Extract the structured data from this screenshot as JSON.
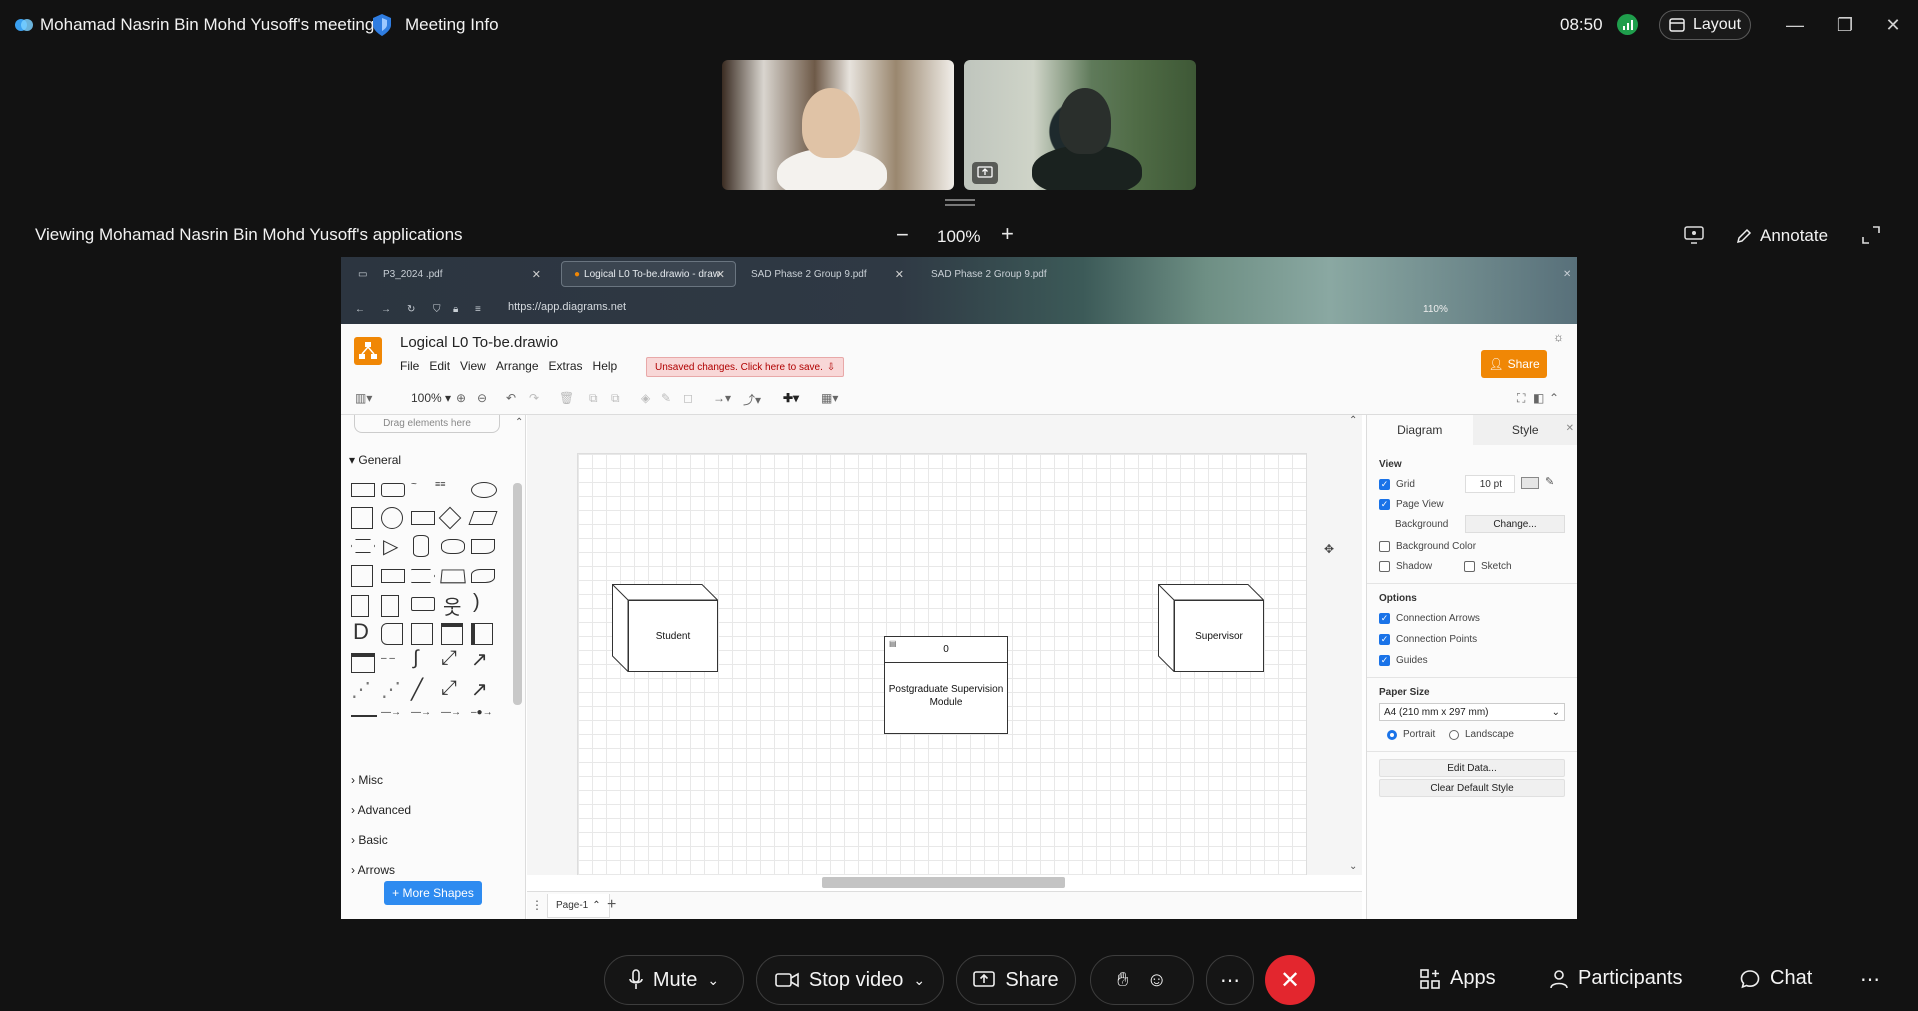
{
  "meeting": {
    "title": "Mohamad Nasrin Bin Mohd Yusoff's meeting",
    "info_label": "Meeting Info",
    "time": "08:50",
    "layout_label": "Layout"
  },
  "viewbar": {
    "viewing_text": "Viewing Mohamad Nasrin Bin Mohd Yusoff's applications",
    "zoom": "100%",
    "annotate_label": "Annotate"
  },
  "browser": {
    "tabs": [
      {
        "label": "P3_2024 .pdf"
      },
      {
        "label": "Logical L0 To-be.drawio - draw"
      },
      {
        "label": "SAD Phase 2 Group 9.pdf"
      },
      {
        "label": "SAD Phase 2 Group 9.pdf"
      }
    ],
    "url": "https://app.diagrams.net",
    "zoom": "110%"
  },
  "drawio": {
    "file_title": "Logical L0 To-be.drawio",
    "menu": [
      "File",
      "Edit",
      "View",
      "Arrange",
      "Extras",
      "Help"
    ],
    "unsaved": "Unsaved changes. Click here to save.",
    "share_label": "Share",
    "zoom": "100%",
    "drag_hint": "Drag elements here",
    "general_label": "General",
    "categories": [
      "Misc",
      "Advanced",
      "Basic",
      "Arrows"
    ],
    "more_shapes": "+ More Shapes",
    "page_tab": "Page-1",
    "diagram": {
      "student": "Student",
      "supervisor": "Supervisor",
      "module_id": "0",
      "module_name": "Postgraduate Supervision Module"
    },
    "panel": {
      "tab_diagram": "Diagram",
      "tab_style": "Style",
      "view_heading": "View",
      "grid": "Grid",
      "grid_size": "10 pt",
      "page_view": "Page View",
      "background": "Background",
      "change": "Change...",
      "background_color": "Background Color",
      "shadow": "Shadow",
      "sketch": "Sketch",
      "options_heading": "Options",
      "connection_arrows": "Connection Arrows",
      "connection_points": "Connection Points",
      "guides": "Guides",
      "paper_heading": "Paper Size",
      "paper_value": "A4 (210 mm x 297 mm)",
      "portrait": "Portrait",
      "landscape": "Landscape",
      "edit_data": "Edit Data...",
      "clear_style": "Clear Default Style"
    }
  },
  "controls": {
    "mute": "Mute",
    "stop_video": "Stop video",
    "share": "Share",
    "apps": "Apps",
    "participants": "Participants",
    "chat": "Chat"
  },
  "colors": {
    "end_call": "#e3262e",
    "drawio_orange": "#f08705",
    "accent_blue": "#2e8bf0"
  }
}
